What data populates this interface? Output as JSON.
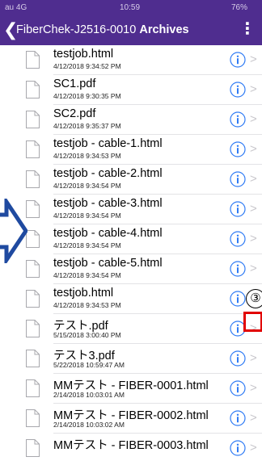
{
  "status_bar": {
    "carrier": "au 4G",
    "time": "10:59",
    "battery": "76%"
  },
  "nav": {
    "back_label": "FiberChek-J2516-0010",
    "title": "Archives",
    "more_label": "⋮"
  },
  "files": [
    {
      "name": "testjob.html",
      "date": "4/12/2018 9:34:52 PM"
    },
    {
      "name": "SC1.pdf",
      "date": "4/12/2018 9:30:35 PM"
    },
    {
      "name": "SC2.pdf",
      "date": "4/12/2018 9:35:37 PM"
    },
    {
      "name": "testjob - cable-1.html",
      "date": "4/12/2018 9:34:53 PM"
    },
    {
      "name": "testjob - cable-2.html",
      "date": "4/12/2018 9:34:54 PM"
    },
    {
      "name": "testjob - cable-3.html",
      "date": "4/12/2018 9:34:54 PM"
    },
    {
      "name": "testjob - cable-4.html",
      "date": "4/12/2018 9:34:54 PM"
    },
    {
      "name": "testjob - cable-5.html",
      "date": "4/12/2018 9:34:54 PM"
    },
    {
      "name": "testjob.html",
      "date": "4/12/2018 9:34:53 PM"
    },
    {
      "name": "テスト.pdf",
      "date": "5/15/2018 3:00:40 PM"
    },
    {
      "name": "テスト3.pdf",
      "date": "5/22/2018 10:59:47 AM"
    },
    {
      "name": "MMテスト - FIBER-0001.html",
      "date": "2/14/2018 10:03:01 AM"
    },
    {
      "name": "MMテスト - FIBER-0002.html",
      "date": "2/14/2018 10:03:02 AM"
    },
    {
      "name": "MMテスト - FIBER-0003.html",
      "date": ""
    }
  ],
  "annotation": {
    "step_marker": "③"
  },
  "colors": {
    "header": "#4f2d8f",
    "info": "#2f7bf5",
    "chevron": "#c8c7cc",
    "highlight": "#e10000",
    "arrow": "#1f4aa0"
  }
}
